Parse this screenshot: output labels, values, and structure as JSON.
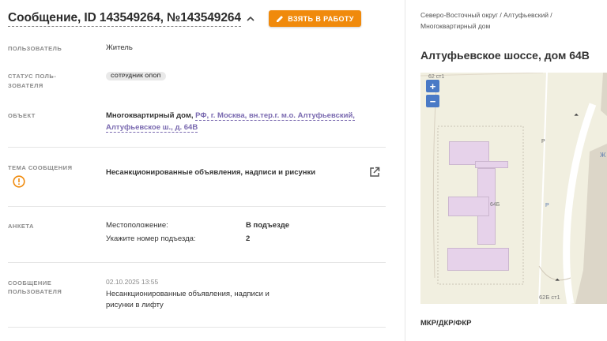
{
  "header": {
    "title": "Сообщение, ID 143549264, №143549264",
    "take_button": "ВЗЯТЬ В РАБОТУ"
  },
  "fields": {
    "user_label": "ПОЛЬЗОВАТЕЛЬ",
    "user_value": "Житель",
    "status_label_1": "СТАТУС ПОЛЬ-",
    "status_label_2": "ЗОВАТЕЛЯ",
    "status_badge": "СОТРУДНИК ОПОП",
    "object_label": "ОБЪЕКТ",
    "object_type": "Многоквартирный дом,",
    "object_address": "РФ, г. Москва, вн.тер.г. м.о. Алтуфьевский, Алтуфьевское ш., д. 64В",
    "topic_label": "ТЕМА СООБЩЕНИЯ",
    "topic_value": "Несанкционированные объявления, надписи и рисунки",
    "survey_label": "АНКЕТА",
    "survey": [
      {
        "key": "Местоположение:",
        "value": "В подъезде"
      },
      {
        "key": "Укажите номер подъезда:",
        "value": "2"
      }
    ],
    "message_label_1": "СООБЩЕНИЕ",
    "message_label_2": "ПОЛЬЗОВАТЕЛЯ",
    "message_date": "02.10.2025 13:55",
    "message_text": "Несанкционированные объявления, надписи и рисунки в лифту"
  },
  "right": {
    "breadcrumb": "Северо-Восточный округ / Алтуфьевский / Многоквартирный дом",
    "address": "Алтуфьевское шоссе, дом 64В",
    "zoom_in": "+",
    "zoom_out": "−",
    "map_labels": {
      "top_left": "62 ст1",
      "building": "64Б",
      "bottom": "62Б ст1",
      "parking_1": "Р",
      "parking_2": "Р",
      "edge": "Ж"
    },
    "section_label": "МКР/ДКР/ФКР"
  },
  "colors": {
    "accent": "#f08a0c",
    "link": "#7a6ab0",
    "zoom": "#4a7ac6",
    "building": "#e6d2ea"
  }
}
